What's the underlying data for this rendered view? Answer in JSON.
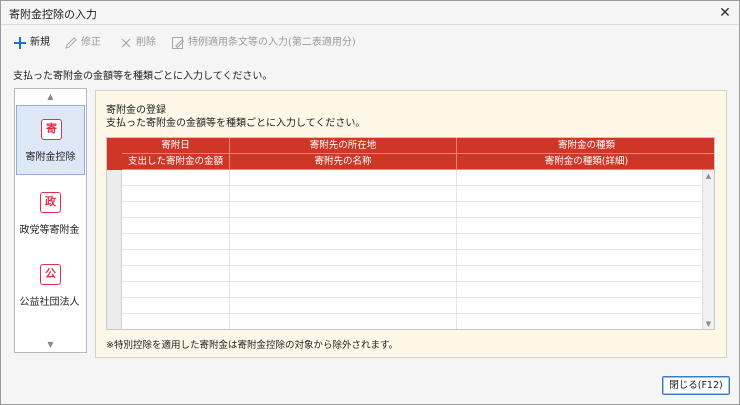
{
  "window": {
    "title": "寄附金控除の入力",
    "close_glyph": "✕"
  },
  "toolbar": {
    "new_label": "新規",
    "edit_label": "修正",
    "delete_label": "削除",
    "special_label": "特例適用条文等の入力(第二表適用分)"
  },
  "instruction": "支払った寄附金の金額等を種類ごとに入力してください。",
  "sidebar": {
    "items": [
      {
        "badge": "寄",
        "label": "寄附金控除",
        "active": true
      },
      {
        "badge": "政",
        "label": "政党等寄附金",
        "active": false
      },
      {
        "badge": "公",
        "label": "公益社団法人",
        "active": false
      }
    ]
  },
  "panel": {
    "title": "寄附金の登録",
    "subtitle": "支払った寄附金の金額等を種類ごとに入力してください。",
    "note": "※特別控除を適用した寄附金は寄附金控除の対象から除外されます。"
  },
  "table": {
    "header_row1": [
      "寄附日",
      "寄附先の所在地",
      "寄附金の種類"
    ],
    "header_row2": [
      "支出した寄附金の金額",
      "寄附先の名称",
      "寄附金の種類(詳細)"
    ],
    "row_count": 10
  },
  "footer": {
    "close_label": "閉じる(F12)"
  },
  "colors": {
    "header_red": "#d03626",
    "badge_red": "#e0304e",
    "panel_bg": "#fdf7e8",
    "accent_blue": "#1a6fd0"
  }
}
